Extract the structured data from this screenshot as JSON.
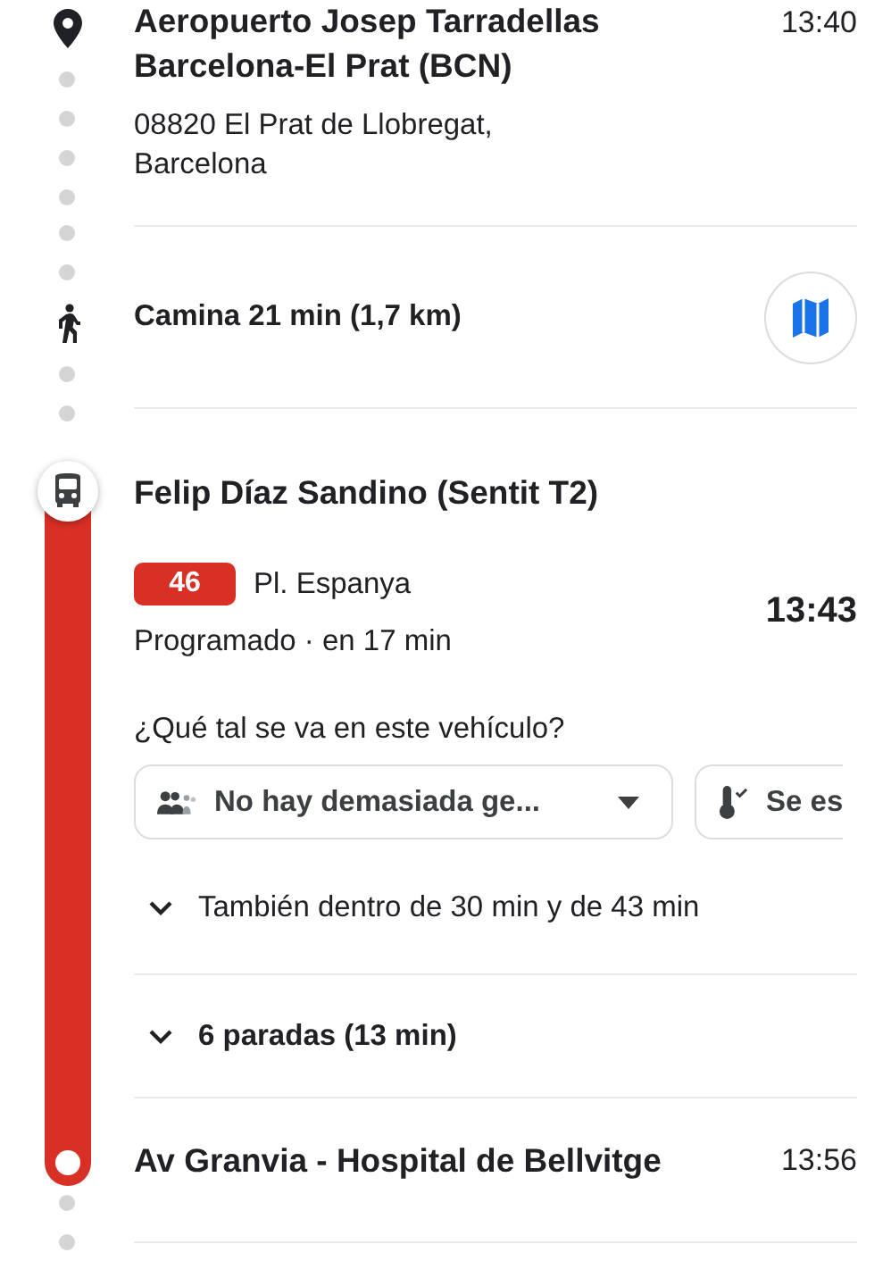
{
  "origin": {
    "name": "Aeropuerto Josep Tarradellas Barcelona-El Prat (BCN)",
    "time": "13:40",
    "address": "08820 El Prat de Llobregat, Barcelona"
  },
  "walk": {
    "text": "Camina 21 min (1,7 km)"
  },
  "transit": {
    "stop_name": "Felip Díaz Sandino (Sentit T2)",
    "line": "46",
    "headsign": "Pl. Espanya",
    "status": "Programado · en 17 min",
    "departure_time": "13:43",
    "question": "¿Qué tal se va en este vehículo?",
    "feedback": [
      {
        "kind": "crowding",
        "label": "No hay demasiada ge..."
      },
      {
        "kind": "temperature",
        "label": "Se es"
      }
    ],
    "expanders": [
      {
        "text": "También dentro de 30 min y de 43 min",
        "expanded": false
      },
      {
        "text": "6 paradas (13 min)",
        "expanded": false
      }
    ],
    "arrival": {
      "name": "Av Granvia - Hospital de Bellvitge",
      "time": "13:56"
    }
  }
}
